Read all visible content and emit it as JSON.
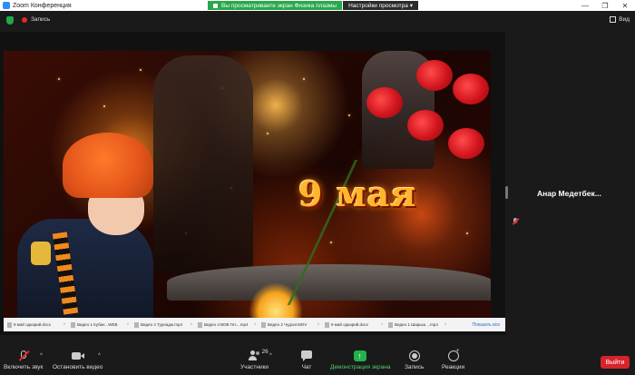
{
  "window": {
    "title": "Zoom Конференция",
    "controls": [
      "—",
      "❐",
      "✕"
    ]
  },
  "share_banner": {
    "sharing_text": "Вы просматриваете экран Физика плазмы",
    "view_options": "Настройки просмотра ▾"
  },
  "topbar": {
    "recording_label": "Запись",
    "view_label": "Вид"
  },
  "slide": {
    "headline": "9 мая"
  },
  "taskbar": {
    "items": [
      "9 май одкарий.docx",
      "Видео 1 Кубан...WEB",
      "Видео 4 Турнадж.mp4",
      "Видео 4 ВОВ Гет....mp4",
      "Видео 2 Чудсиг.MOV",
      "9 май одкарий.docx",
      "Видео 1 Шарыш ...mp4"
    ],
    "show_all": "Показать все"
  },
  "participant": {
    "name": "Анар Медетбек..."
  },
  "toolbar": {
    "mute_label": "Включить звук",
    "video_label": "Остановить видео",
    "participants_label": "Участники",
    "participants_count": "26",
    "chat_label": "Чат",
    "share_label": "Демонстрация экрана",
    "record_label": "Запись",
    "reactions_label": "Реакции",
    "leave_label": "Выйти"
  },
  "colors": {
    "accent_green": "#29a84a",
    "leave_red": "#d6232c",
    "toolbar_bg": "#1a1a1a"
  }
}
